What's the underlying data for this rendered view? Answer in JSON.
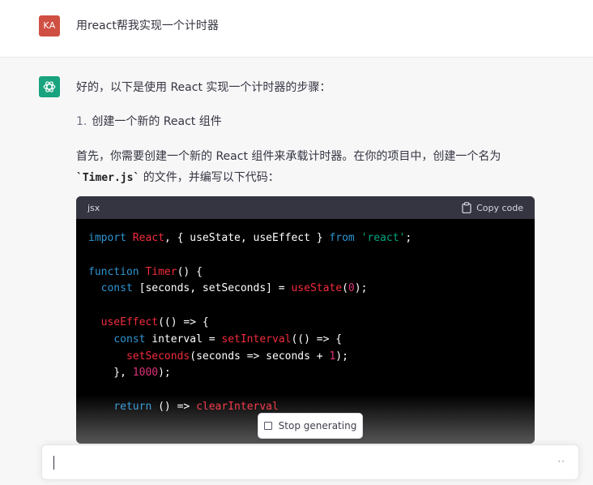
{
  "user": {
    "avatar_initials": "KA",
    "message": "用react帮我实现一个计时器"
  },
  "assistant": {
    "logo": "openai-logo-icon",
    "intro": "好的，以下是使用 React 实现一个计时器的步骤：",
    "step_number": "1.",
    "step_text": "创建一个新的 React 组件",
    "para_part1": "首先，你需要创建一个新的 React 组件来承载计时器。在你的项目中，创建一个名为 ",
    "para_code": "`Timer.js`",
    "para_part2": " 的文件，并编写以下代码：",
    "code": {
      "language": "jsx",
      "copy_label": "Copy code"
    }
  },
  "stop_button_label": "Stop generating",
  "input": {
    "placeholder": "",
    "value": "",
    "menu_dots": "··"
  },
  "colors": {
    "avatar": "#cf4f43",
    "logo": "#19a37f",
    "code_keyword": "#2e95d3",
    "code_function": "#f22c3d",
    "code_string": "#00a67d",
    "code_number": "#df3079"
  }
}
